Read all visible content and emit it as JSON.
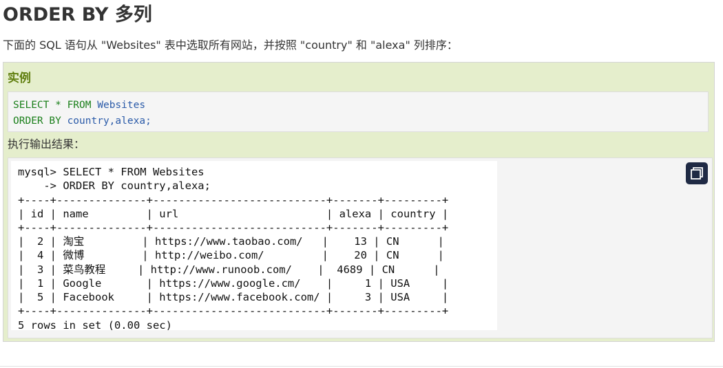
{
  "section": {
    "title": "ORDER BY 多列",
    "intro": "下面的 SQL 语句从 \"Websites\" 表中选取所有网站，并按照 \"country\" 和 \"alexa\" 列排序："
  },
  "example": {
    "heading": "实例",
    "code_line1": {
      "kw1": "SELECT * FROM",
      "id1": "Websites"
    },
    "code_line2": {
      "kw1": "ORDER BY",
      "id1": "country,alexa;"
    }
  },
  "output": {
    "label": "执行输出结果：",
    "lines": [
      "mysql> SELECT * FROM Websites",
      "    -> ORDER BY country,alexa;",
      "+----+--------------+---------------------------+-------+---------+",
      "| id | name         | url                       | alexa | country |",
      "+----+--------------+---------------------------+-------+---------+",
      "|  2 | 淘宝         | https://www.taobao.com/   |    13 | CN      |",
      "|  4 | 微博         | http://weibo.com/         |    20 | CN      |",
      "|  3 | 菜鸟教程     | http://www.runoob.com/    |  4689 | CN      |",
      "|  1 | Google       | https://www.google.cm/    |     1 | USA     |",
      "|  5 | Facebook     | https://www.facebook.com/ |     3 | USA     |",
      "+----+--------------+---------------------------+-------+---------+",
      "5 rows in set (0.00 sec)"
    ],
    "copy_icon": "copy-icon"
  }
}
